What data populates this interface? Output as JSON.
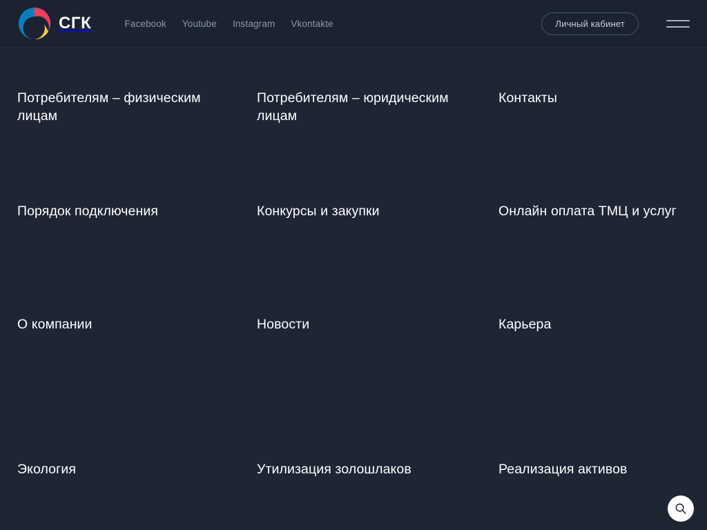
{
  "header": {
    "brand": {
      "name": "СГК",
      "logo_icon": "sgk-swirl-logo-icon",
      "logo_colors": {
        "red": "#e8415b",
        "blue": "#0d7ebd",
        "yellow": "#f5cc3e"
      }
    },
    "social_links": [
      {
        "label": "Facebook"
      },
      {
        "label": "Youtube"
      },
      {
        "label": "Instagram"
      },
      {
        "label": "Vkontakte"
      }
    ],
    "account_button_label": "Личный кабинет",
    "menu_toggle_icon": "hamburger-menu-icon",
    "background_color": "#1b2332"
  },
  "menu": {
    "items": [
      {
        "label": "Потребителям – физическим лицам"
      },
      {
        "label": "Потребителям – юридическим лицам"
      },
      {
        "label": "Контакты"
      },
      {
        "label": "Порядок подключения"
      },
      {
        "label": "Конкурсы и закупки"
      },
      {
        "label": "Онлайн оплата ТМЦ и услуг"
      },
      {
        "label": "О компании"
      },
      {
        "label": "Новости"
      },
      {
        "label": "Карьера"
      },
      {
        "label": "Экология"
      },
      {
        "label": "Утилизация золошлаков"
      },
      {
        "label": "Реализация активов"
      }
    ],
    "background_color": "#1e2634",
    "text_color": "#ffffff"
  },
  "search": {
    "icon": "search-icon",
    "button_color": "#ffffff"
  }
}
